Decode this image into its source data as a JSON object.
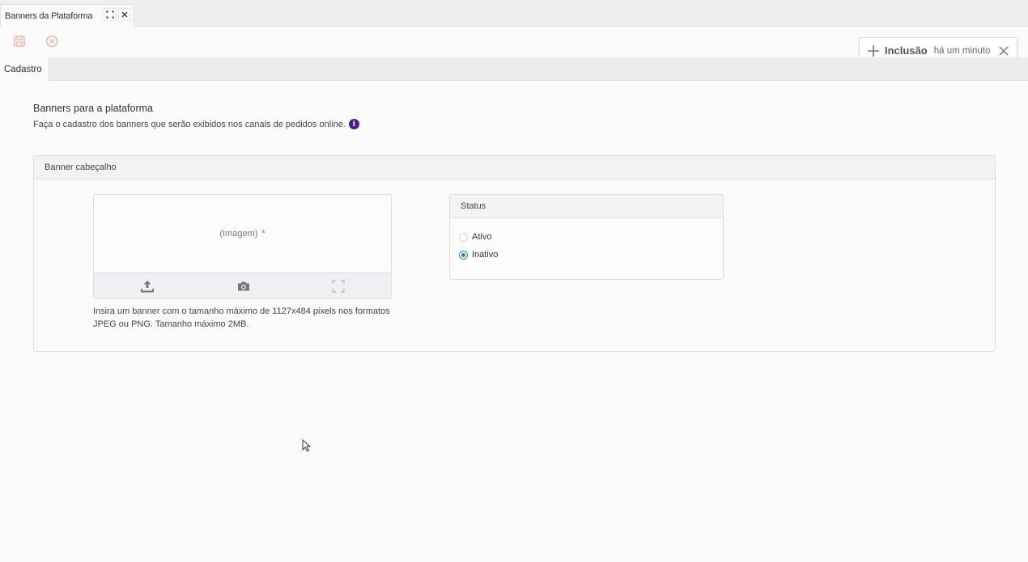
{
  "tab": {
    "title": "Banners da Plataforma",
    "expand_icon": "expand-icon",
    "close_icon": "close-icon"
  },
  "toolbar": {
    "save_icon": "save-icon",
    "cancel_icon": "cancel-icon",
    "icon_color": "#f0a8a0"
  },
  "notification": {
    "title": "Inclusão",
    "time": "há um minuto",
    "plus_icon": "plus-icon",
    "close_icon": "close-icon"
  },
  "inner_tabs": [
    {
      "label": "Cadastro"
    }
  ],
  "page": {
    "title": "Banners para a plataforma",
    "description": "Faça o cadastro dos banners que serão exibidos nos canais de pedidos online.",
    "info_glyph": "i",
    "info_color": "#4a1a8c"
  },
  "banner_section": {
    "title": "Banner cabeçalho",
    "image": {
      "placeholder": "(Imagem)",
      "required_mark": "*",
      "actions": [
        "upload-icon",
        "camera-icon",
        "fullscreen-icon"
      ]
    },
    "help_text": "Insira um banner com o tamanho máximo de 1127x484 pixels nos formatos JPEG ou PNG. Tamanho máximo 2MB."
  },
  "status": {
    "title": "Status",
    "options": [
      {
        "label": "Ativo",
        "checked": false
      },
      {
        "label": "Inativo",
        "checked": true
      }
    ],
    "accent": "#2a7fc1"
  }
}
